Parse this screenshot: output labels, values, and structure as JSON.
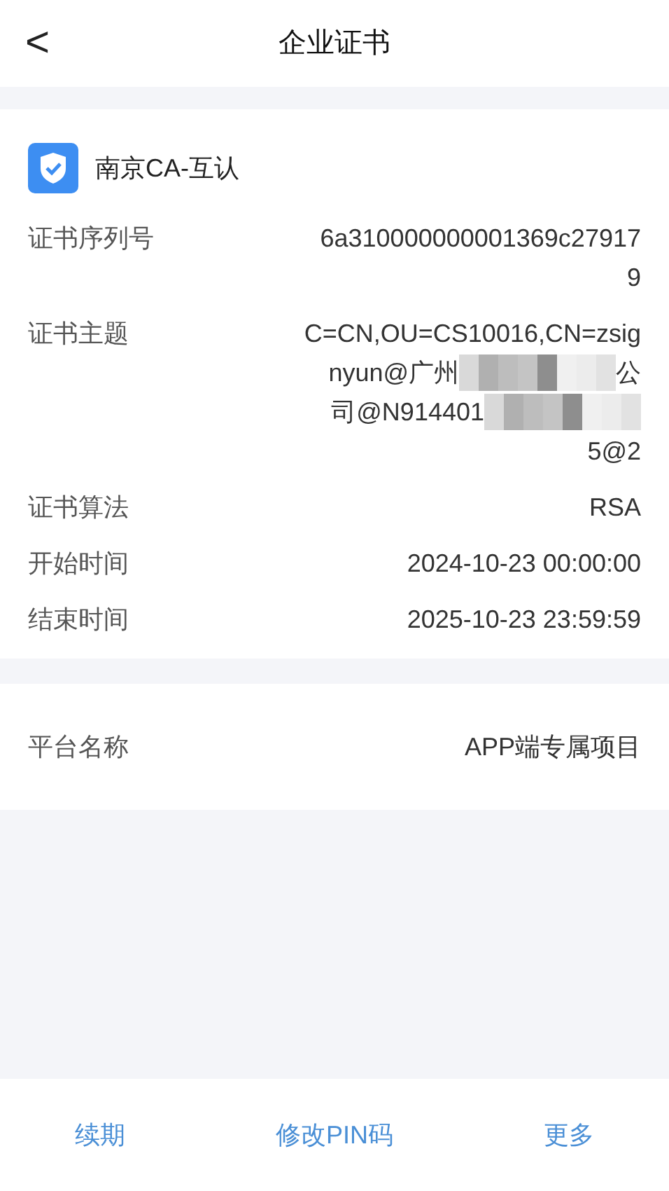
{
  "header": {
    "back": "<",
    "title": "企业证书"
  },
  "certificate": {
    "issuer": "南京CA-互认",
    "fields": [
      {
        "label": "证书序列号",
        "lines": [
          [
            {
              "kind": "text",
              "text": "6a310000000001369c27917"
            }
          ],
          [
            {
              "kind": "text",
              "text": "9"
            }
          ]
        ]
      },
      {
        "label": "证书主题",
        "lines": [
          [
            {
              "kind": "text",
              "text": "C=CN,OU=CS10016,CN=zsig"
            }
          ],
          [
            {
              "kind": "text",
              "text": "nyun@广州"
            },
            {
              "kind": "mosaic"
            },
            {
              "kind": "text",
              "text": "公"
            }
          ],
          [
            {
              "kind": "text",
              "text": "司@N914401"
            },
            {
              "kind": "mosaic"
            }
          ],
          [
            {
              "kind": "text",
              "text": "5@2"
            }
          ]
        ]
      },
      {
        "label": "证书算法",
        "lines": [
          [
            {
              "kind": "text",
              "text": "RSA"
            }
          ]
        ]
      },
      {
        "label": "开始时间",
        "lines": [
          [
            {
              "kind": "text",
              "text": "2024-10-23 00:00:00"
            }
          ]
        ]
      },
      {
        "label": "结束时间",
        "lines": [
          [
            {
              "kind": "text",
              "text": "2025-10-23 23:59:59"
            }
          ]
        ]
      }
    ]
  },
  "platform": {
    "label": "平台名称",
    "value": "APP端专属项目"
  },
  "actions": [
    "续期",
    "修改PIN码",
    "更多"
  ]
}
